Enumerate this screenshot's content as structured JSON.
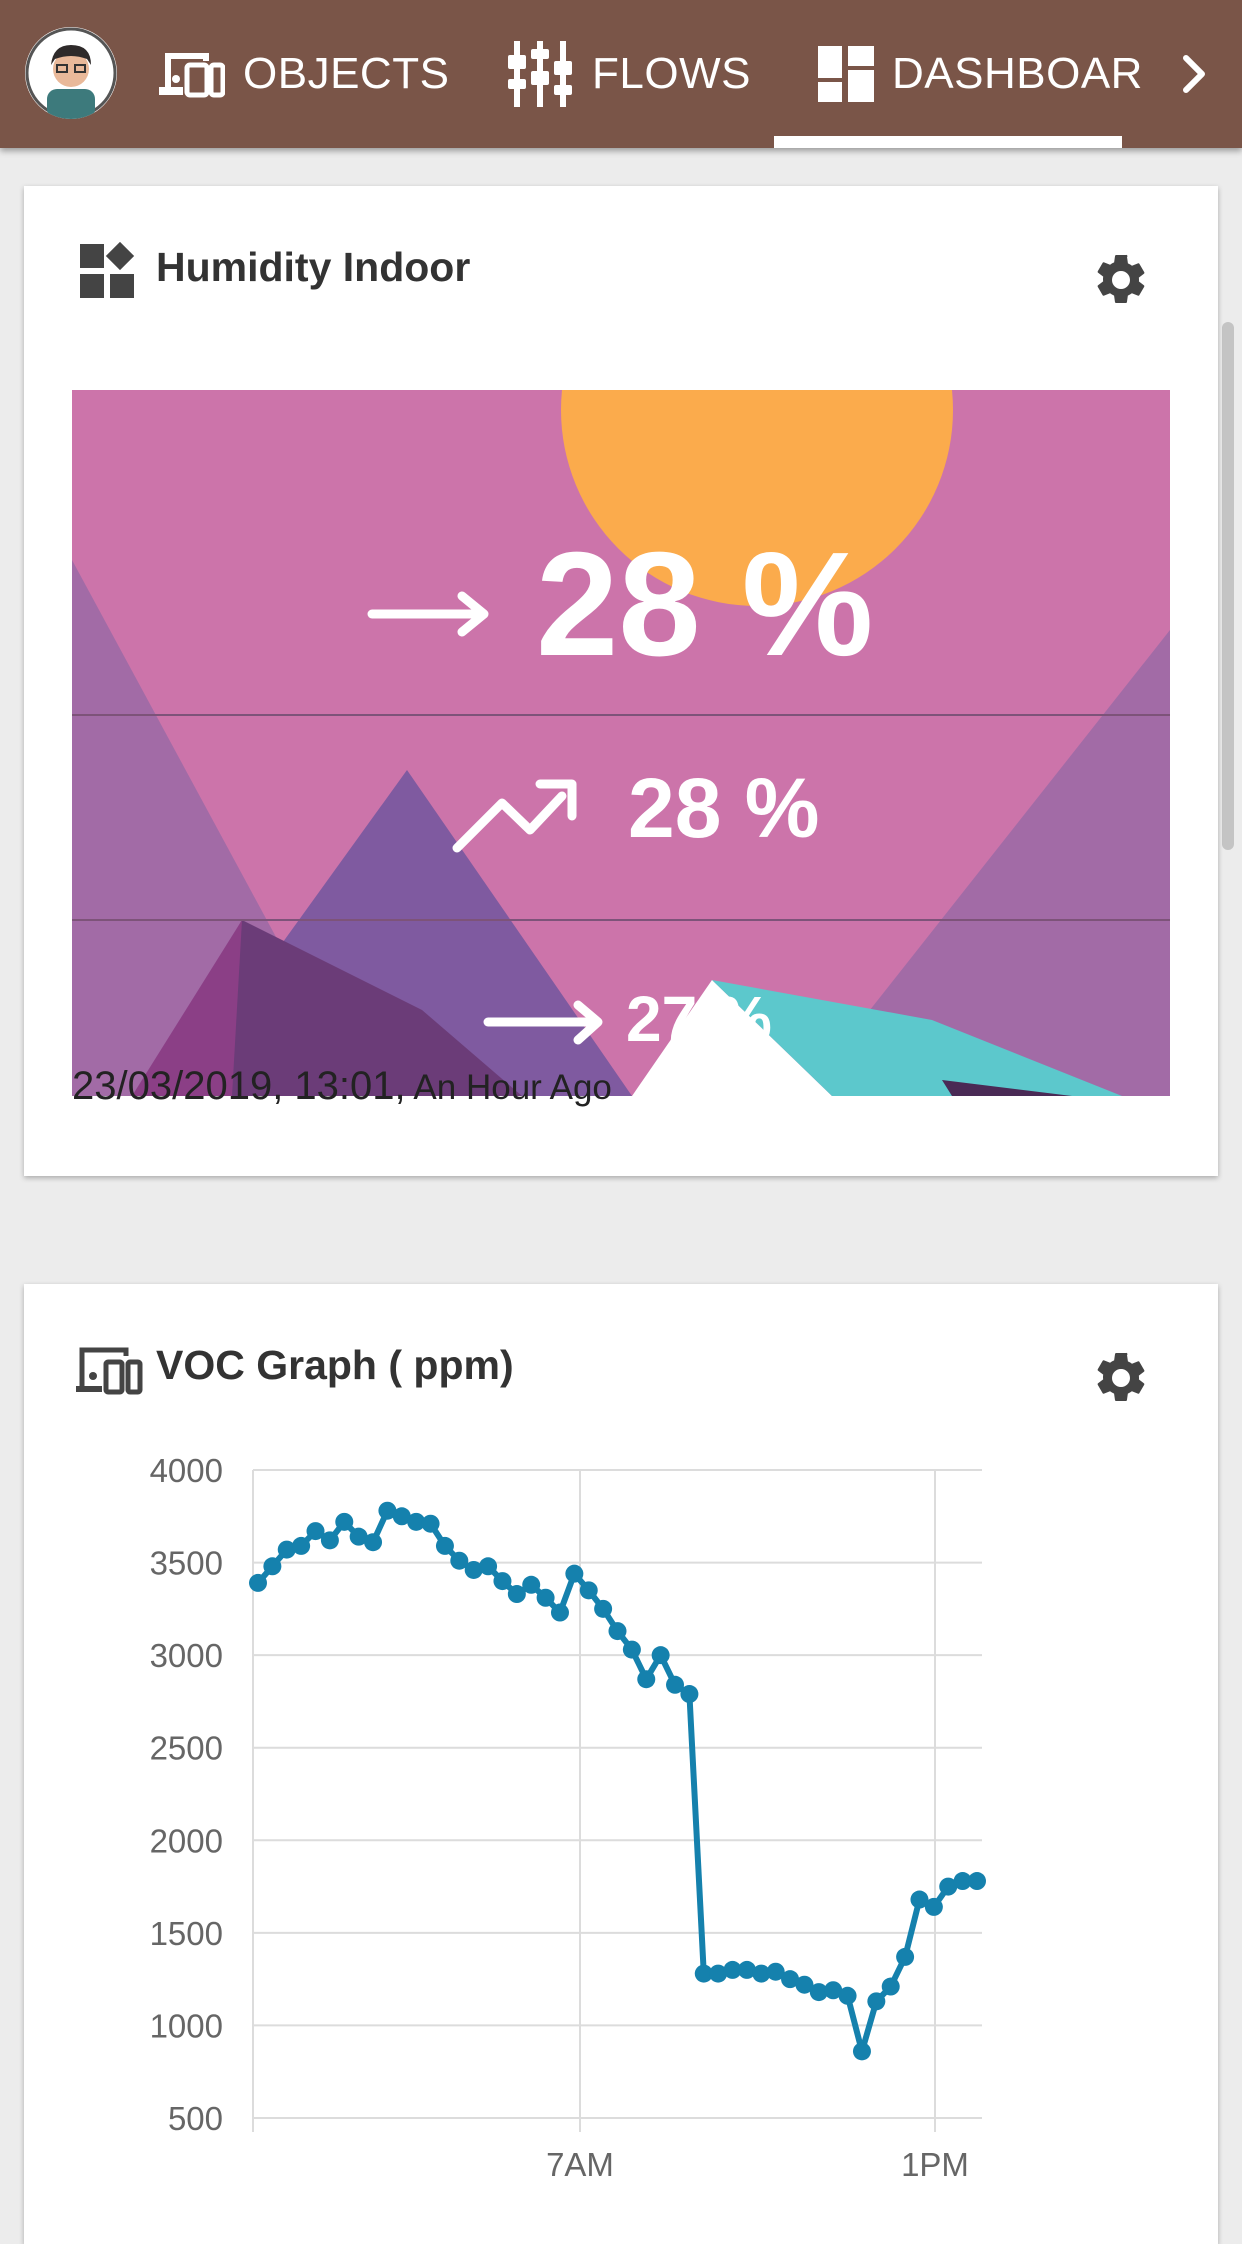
{
  "nav": {
    "tabs": [
      {
        "label": "OBJECTS",
        "icon": "devices-icon"
      },
      {
        "label": "FLOWS",
        "icon": "flows-icon"
      },
      {
        "label": "DASHBOAR",
        "icon": "dashboard-icon",
        "active": true
      }
    ],
    "chevron": "chevron-right-icon"
  },
  "humidity_card": {
    "title": "Humidity Indoor",
    "current": {
      "value": "28 %",
      "trend": "steady"
    },
    "second": {
      "value": "28 %",
      "trend": "rising"
    },
    "third": {
      "value": "27 %",
      "trend": "steady"
    },
    "timestamp": "23/03/2019, 13:01,",
    "relative": " An Hour Ago"
  },
  "voc_card": {
    "title": "VOC Graph ( ppm)"
  },
  "colors": {
    "nav_bg": "#7a5548",
    "line": "#1581ad",
    "hero_bg": "#cc74aa"
  },
  "chart_data": {
    "type": "line",
    "title": "VOC Graph ( ppm)",
    "xlabel": "",
    "ylabel": "",
    "ylim": [
      500,
      4000
    ],
    "y_ticks": [
      "4000",
      "3500",
      "3000",
      "2500",
      "2000",
      "1500",
      "1000",
      "500"
    ],
    "x_tick_labels": [
      "7AM",
      "1PM"
    ],
    "x": [
      0,
      1,
      2,
      3,
      4,
      5,
      6,
      7,
      8,
      9,
      10,
      11,
      12,
      13,
      14,
      15,
      16,
      17,
      18,
      19,
      20,
      21,
      22,
      23,
      24,
      25,
      26,
      27,
      28,
      29,
      30,
      31,
      32,
      33,
      34,
      35,
      36,
      37,
      38,
      39,
      40,
      41,
      42,
      43,
      44,
      45,
      46,
      47,
      48,
      49,
      50
    ],
    "series": [
      {
        "values": [
          3390,
          3480,
          3570,
          3590,
          3670,
          3620,
          3720,
          3640,
          3610,
          3780,
          3750,
          3720,
          3710,
          3590,
          3510,
          3460,
          3480,
          3400,
          3330,
          3380,
          3310,
          3230,
          3440,
          3350,
          3250,
          3130,
          3030,
          2870,
          3000,
          2840,
          2790,
          1280,
          1280,
          1300,
          1300,
          1280,
          1290,
          1250,
          1220,
          1180,
          1190,
          1160,
          860,
          1130,
          1210,
          1370,
          1680,
          1640,
          1750,
          1780,
          1780
        ]
      }
    ],
    "grid": true,
    "legend": "none"
  }
}
